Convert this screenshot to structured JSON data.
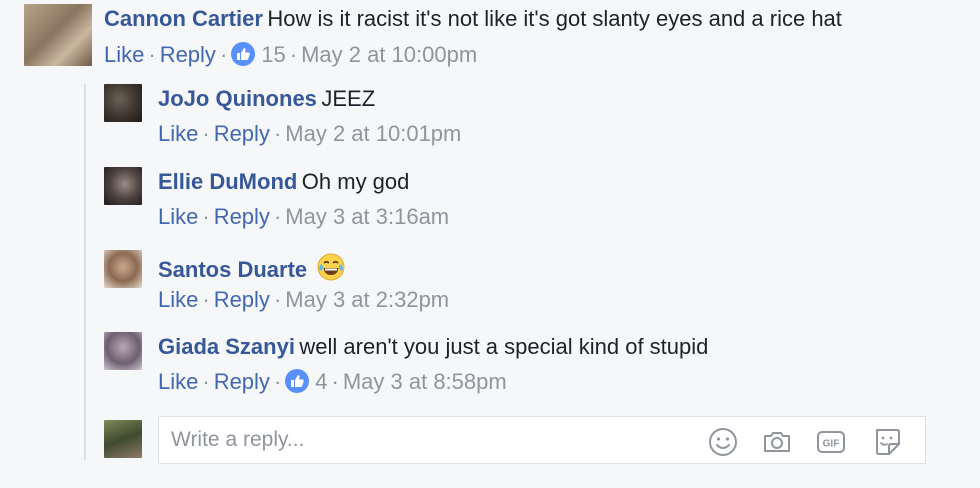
{
  "actions": {
    "like": "Like",
    "reply": "Reply"
  },
  "comments": [
    {
      "author": "Cannon Cartier",
      "text": "How is it racist it's not like it's got slanty eyes and a rice hat",
      "likes": "15",
      "time": "May 2 at 10:00pm"
    },
    {
      "author": "JoJo Quinones",
      "text": "JEEZ",
      "time": "May 2 at 10:01pm"
    },
    {
      "author": "Ellie DuMond",
      "text": "Oh my god",
      "time": "May 3 at 3:16am"
    },
    {
      "author": "Santos Duarte",
      "text": "",
      "emoji": "tears-of-joy-emoji",
      "time": "May 3 at 2:32pm"
    },
    {
      "author": "Giada Szanyi",
      "text": "well aren't you just a special kind of stupid",
      "likes": "4",
      "time": "May 3 at 8:58pm"
    }
  ],
  "reply_box": {
    "placeholder": "Write a reply..."
  },
  "icons": [
    "emoji-icon",
    "camera-icon",
    "gif-icon",
    "sticker-icon"
  ],
  "colors": {
    "name": "#365899",
    "link": "#4267b2",
    "meta": "#90949c",
    "like_badge": "#5890ff",
    "background": "#f6f7f9"
  }
}
